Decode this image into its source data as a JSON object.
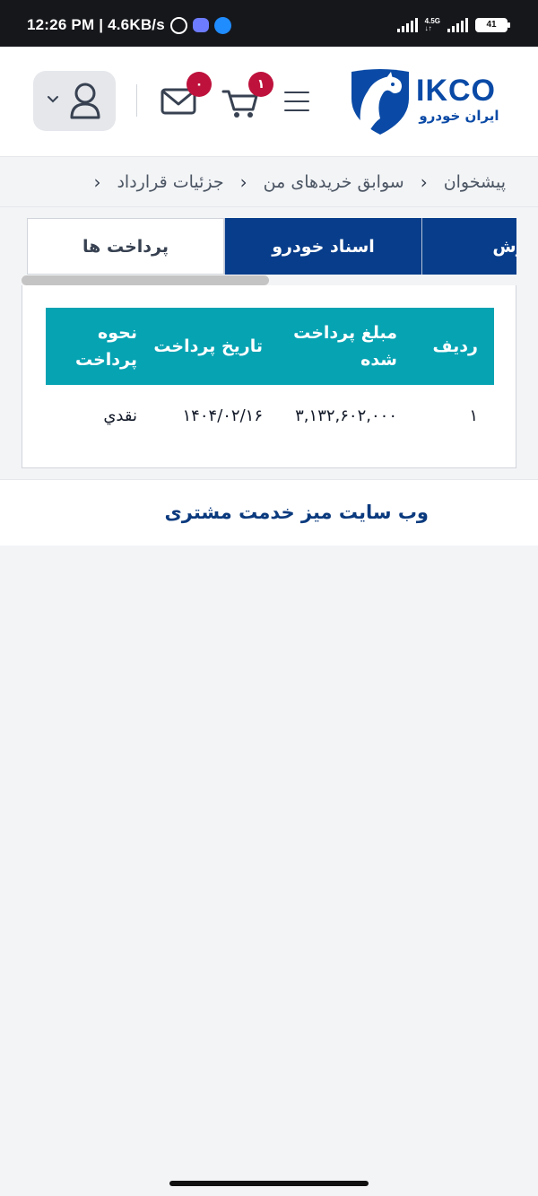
{
  "status_bar": {
    "time_speed": "12:26 PM | 4.6KB/s",
    "network": "4.5G",
    "battery": "41"
  },
  "header": {
    "logo_text_en": "IKCO",
    "logo_text_fa": "ایران خودرو",
    "cart_count": "۱",
    "messages_count": "۰",
    "icons": [
      "menu-icon",
      "cart-icon",
      "mail-icon",
      "user-icon",
      "chevron-down-icon"
    ]
  },
  "breadcrumb": {
    "items": [
      "پیشخوان",
      "سوابق خریدهای من",
      "جزئیات قرارداد"
    ]
  },
  "tabs": [
    {
      "label": "پرداخت ها",
      "active": true
    },
    {
      "label": "اسناد خودرو",
      "active": false
    },
    {
      "label": "فروش",
      "active": false
    }
  ],
  "payments_table": {
    "headers": [
      "ردیف",
      "مبلغ پرداخت شده",
      "تاریخ پرداخت",
      "نحوه پرداخت"
    ],
    "rows": [
      [
        "۱",
        "۳,۱۳۲,۶۰۲,۰۰۰",
        "۱۴۰۴/۰۲/۱۶",
        "نقدي"
      ]
    ]
  },
  "footer": {
    "link_label": "وب سایت میز خدمت مشتری"
  },
  "colors": {
    "primary": "#073d8a",
    "teal": "#06a3b3",
    "badge": "#be123c"
  }
}
